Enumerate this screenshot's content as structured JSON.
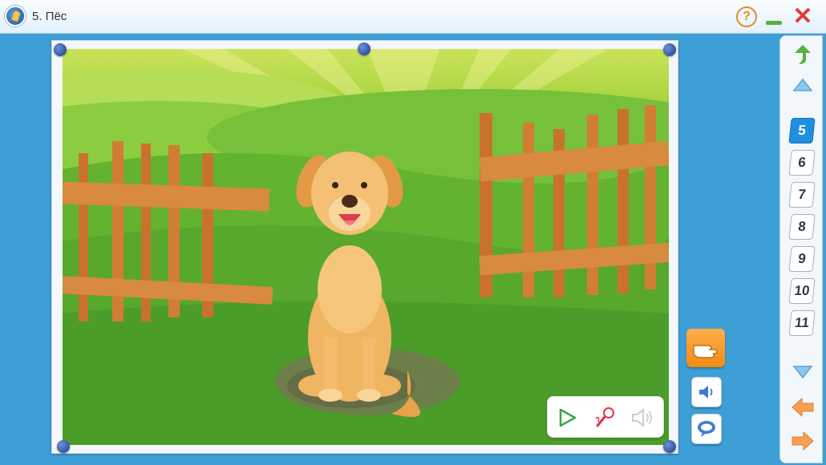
{
  "window": {
    "title": "5. Пёс",
    "help_label": "?",
    "close_label": "✕"
  },
  "scene": {
    "subject": "dog-illustration"
  },
  "tools": {
    "hand_icon": "pointing-hand-icon",
    "audio_icon": "speaker-icon",
    "chat_icon": "speech-bubble-icon"
  },
  "media": {
    "play_icon": "play-icon",
    "record_icon": "microphone-icon",
    "sound_icon": "speaker-disabled-icon"
  },
  "navigation": {
    "pages": [
      {
        "label": "5",
        "active": true
      },
      {
        "label": "6",
        "active": false
      },
      {
        "label": "7",
        "active": false
      },
      {
        "label": "8",
        "active": false
      },
      {
        "label": "9",
        "active": false
      },
      {
        "label": "10",
        "active": false
      },
      {
        "label": "11",
        "active": false
      }
    ]
  },
  "colors": {
    "window_bg": "#3e9ed6",
    "accent_orange": "#f28a14",
    "active_page": "#1f8fe0",
    "close_red": "#e23b3b",
    "arrow_green": "#5aae3a"
  }
}
